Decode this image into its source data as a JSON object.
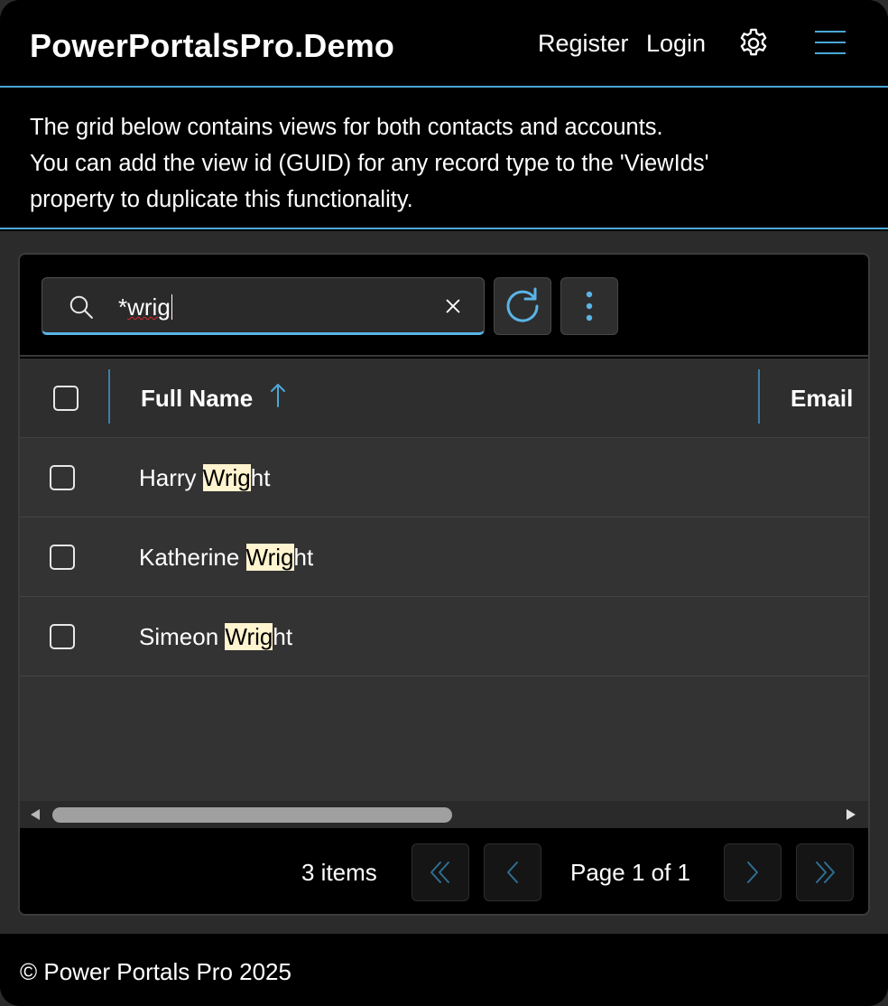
{
  "header": {
    "brand": "PowerPortalsPro.Demo",
    "register_label": "Register",
    "login_label": "Login",
    "settings_icon": "gear-icon",
    "menu_icon": "hamburger-icon",
    "accent_color": "#4aa8d8"
  },
  "intro": {
    "line1": "The grid below contains views for both contacts and accounts.",
    "line2": "You can add the view id (GUID) for any record type to the 'ViewIds'",
    "line3": "property to duplicate this functionality."
  },
  "toolbar": {
    "search_prefix": "*",
    "search_query": "wrig",
    "search_icon": "search-icon",
    "clear_icon": "close-icon",
    "refresh_icon": "refresh-icon",
    "more_icon": "more-vertical-icon"
  },
  "grid": {
    "columns": [
      {
        "label": "Full Name",
        "sort": "ascending"
      },
      {
        "label": "Email"
      }
    ],
    "rows": [
      {
        "before": "Harry ",
        "match": "Wrig",
        "after": "ht"
      },
      {
        "before": "Katherine ",
        "match": "Wrig",
        "after": "ht"
      },
      {
        "before": "Simeon ",
        "match": "Wrig",
        "after": "ht"
      }
    ],
    "highlight_color": "#fff4cf"
  },
  "pager": {
    "items_label": "3 items",
    "page_label": "Page 1 of 1",
    "current_page": 1,
    "total_pages": 1
  },
  "footer": {
    "text": "© Power Portals Pro 2025"
  }
}
